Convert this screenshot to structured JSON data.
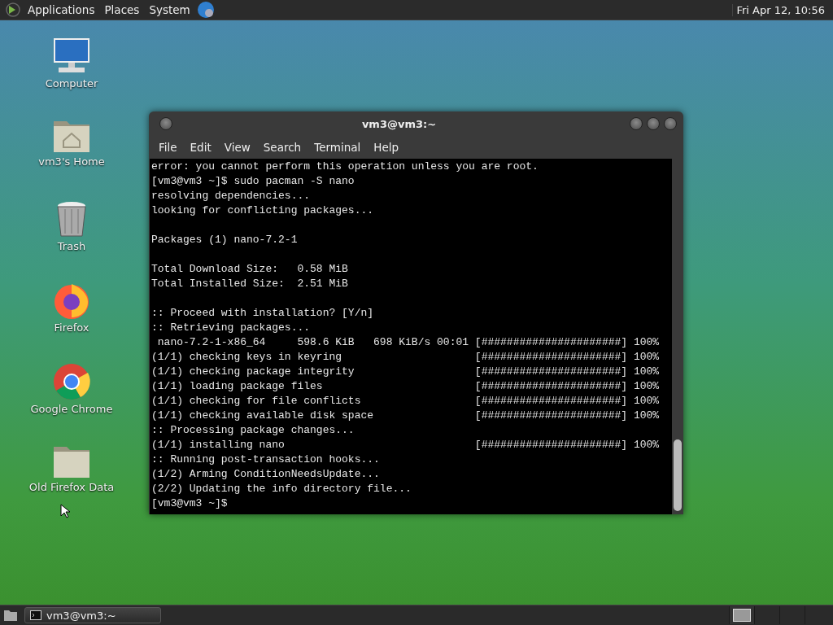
{
  "top_panel": {
    "menus": [
      "Applications",
      "Places",
      "System"
    ],
    "clock": "Fri Apr 12, 10:56"
  },
  "desktop_icons": [
    {
      "kind": "monitor",
      "label": "Computer"
    },
    {
      "kind": "home",
      "label": "vm3's Home"
    },
    {
      "kind": "trash",
      "label": "Trash"
    },
    {
      "kind": "firefox",
      "label": "Firefox"
    },
    {
      "kind": "chrome",
      "label": "Google Chrome"
    },
    {
      "kind": "folder",
      "label": "Old Firefox Data"
    }
  ],
  "window": {
    "title": "vm3@vm3:~",
    "menu": [
      "File",
      "Edit",
      "View",
      "Search",
      "Terminal",
      "Help"
    ],
    "terminal_blocks": [
      [
        "error: you cannot perform this operation unless you are root.",
        "[vm3@vm3 ~]$ sudo pacman -S nano",
        "resolving dependencies...",
        "looking for conflicting packages..."
      ],
      [
        "Packages (1) nano-7.2-1"
      ],
      [
        "Total Download Size:   0.58 MiB",
        "Total Installed Size:  2.51 MiB"
      ],
      [
        ":: Proceed with installation? [Y/n]",
        ":: Retrieving packages...",
        " nano-7.2-1-x86_64     598.6 KiB   698 KiB/s 00:01 [######################] 100%",
        "(1/1) checking keys in keyring                     [######################] 100%",
        "(1/1) checking package integrity                   [######################] 100%",
        "(1/1) loading package files                        [######################] 100%",
        "(1/1) checking for file conflicts                  [######################] 100%",
        "(1/1) checking available disk space                [######################] 100%",
        ":: Processing package changes...",
        "(1/1) installing nano                              [######################] 100%",
        ":: Running post-transaction hooks...",
        "(1/2) Arming ConditionNeedsUpdate...",
        "(2/2) Updating the info directory file...",
        "[vm3@vm3 ~]$"
      ]
    ]
  },
  "taskbar": {
    "tasks": [
      {
        "label": "vm3@vm3:~",
        "selected": false
      }
    ],
    "workspaces": [
      {
        "selected": true
      },
      {
        "selected": false
      },
      {
        "selected": false
      },
      {
        "selected": false
      }
    ]
  }
}
